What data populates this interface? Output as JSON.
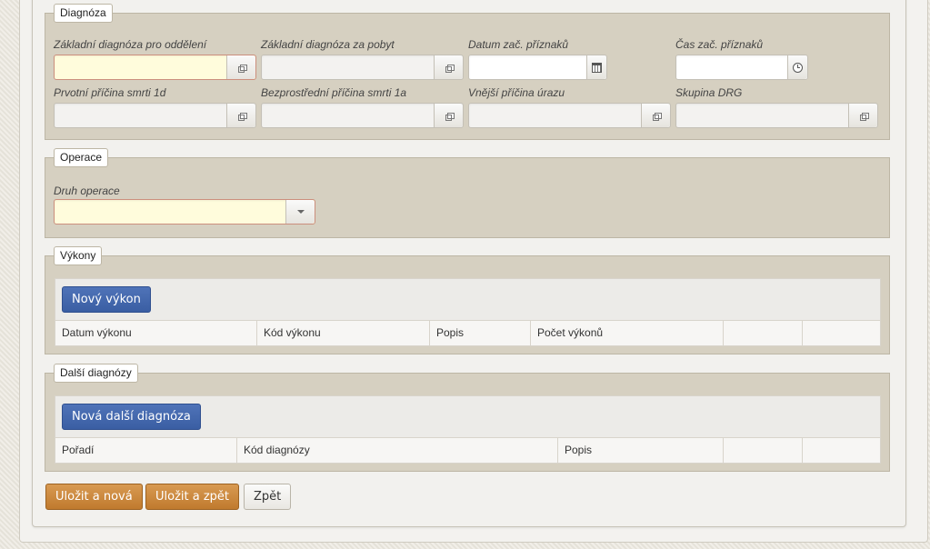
{
  "diagnoza": {
    "legend": "Diagnóza",
    "fields": [
      {
        "label": "Základní diagnóza pro oddělení",
        "value": ""
      },
      {
        "label": "Základní diagnóza za pobyt",
        "value": ""
      },
      {
        "label": "Datum zač. příznaků",
        "value": ""
      },
      {
        "label": "Čas zač. příznaků",
        "value": ""
      },
      {
        "label": "Prvotní příčina smrti 1d",
        "value": ""
      },
      {
        "label": "Bezprostřední příčina smrti 1a",
        "value": ""
      },
      {
        "label": "Vnější příčina úrazu",
        "value": ""
      },
      {
        "label": "Skupina DRG",
        "value": ""
      }
    ]
  },
  "operace": {
    "legend": "Operace",
    "druh_label": "Druh operace",
    "druh_value": ""
  },
  "vykony": {
    "legend": "Výkony",
    "new_button": "Nový výkon",
    "columns": [
      "Datum výkonu",
      "Kód výkonu",
      "Popis",
      "Počet výkonů",
      "",
      ""
    ]
  },
  "dalsi_diagnozy": {
    "legend": "Další diagnózy",
    "new_button": "Nová další diagnóza",
    "columns": [
      "Pořadí",
      "Kód diagnózy",
      "Popis",
      "",
      ""
    ]
  },
  "actions": {
    "save_new": "Uložit a nová",
    "save_back": "Uložit a zpět",
    "back": "Zpět"
  },
  "icons": {
    "picker": "popup-window-icon",
    "date": "calendar-icon",
    "time": "clock-icon",
    "dropdown": "caret-down-icon"
  },
  "colors": {
    "fieldset_bg": "#d6d0c1",
    "required_bg": "#fffcdc",
    "primary_button": "#3a5ea3",
    "save_button": "#c07a2e"
  }
}
